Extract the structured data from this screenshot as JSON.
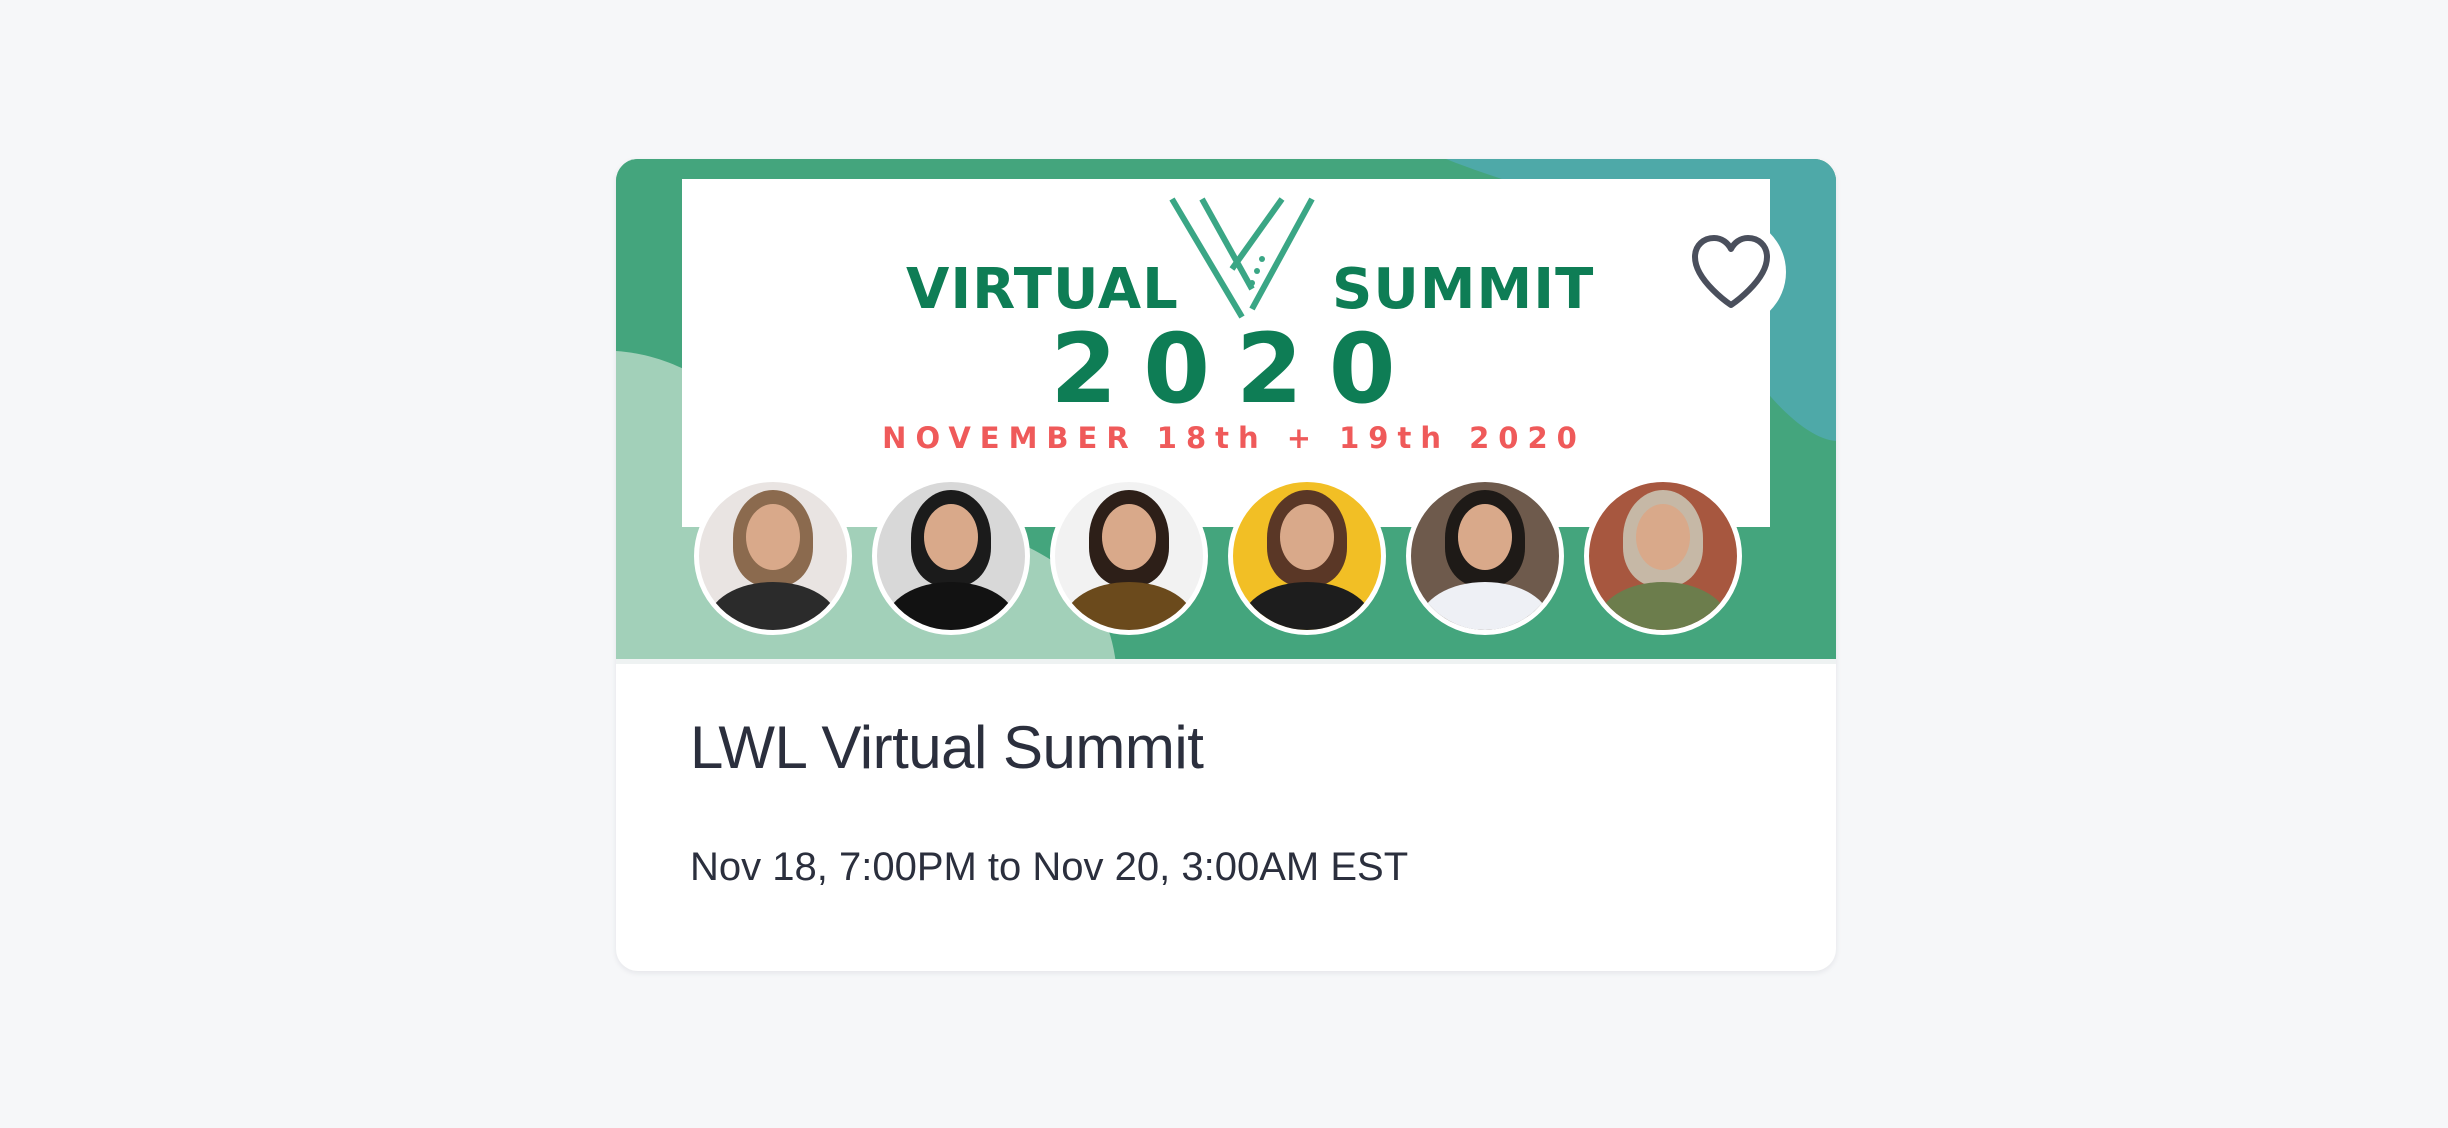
{
  "event": {
    "title": "LWL Virtual Summit",
    "datetime": "Nov 18, 7:00PM to Nov 20, 3:00AM EST"
  },
  "banner": {
    "word_left": "VIRTUAL",
    "word_right": "SUMMIT",
    "year": "2020",
    "dates": "NOVEMBER 18th + 19th 2020",
    "colors": {
      "green": "#44a57d",
      "teal": "#4ea9a8",
      "light_green": "#a2d0b9",
      "brand_text": "#0e7d55",
      "date_text": "#ef5a5a"
    }
  },
  "favorite_icon": "heart-outline-icon",
  "speakers": [
    {
      "name": "speaker-1",
      "bg": "#e9e4e2",
      "hair": "#8b6a4e",
      "top": "#2b2b2b"
    },
    {
      "name": "speaker-2",
      "bg": "#d8d8d8",
      "hair": "#1b1b1b",
      "top": "#121212"
    },
    {
      "name": "speaker-3",
      "bg": "#f2f2f2",
      "hair": "#2d1f18",
      "top": "#6b4a1c"
    },
    {
      "name": "speaker-4",
      "bg": "#f2bf25",
      "hair": "#5a3726",
      "top": "#1d1d1d"
    },
    {
      "name": "speaker-5",
      "bg": "#6e5a4c",
      "hair": "#1e1a17",
      "top": "#eef0f5"
    },
    {
      "name": "speaker-6",
      "bg": "#a7573f",
      "hair": "#c6b8a6",
      "top": "#6c7d4c"
    }
  ]
}
